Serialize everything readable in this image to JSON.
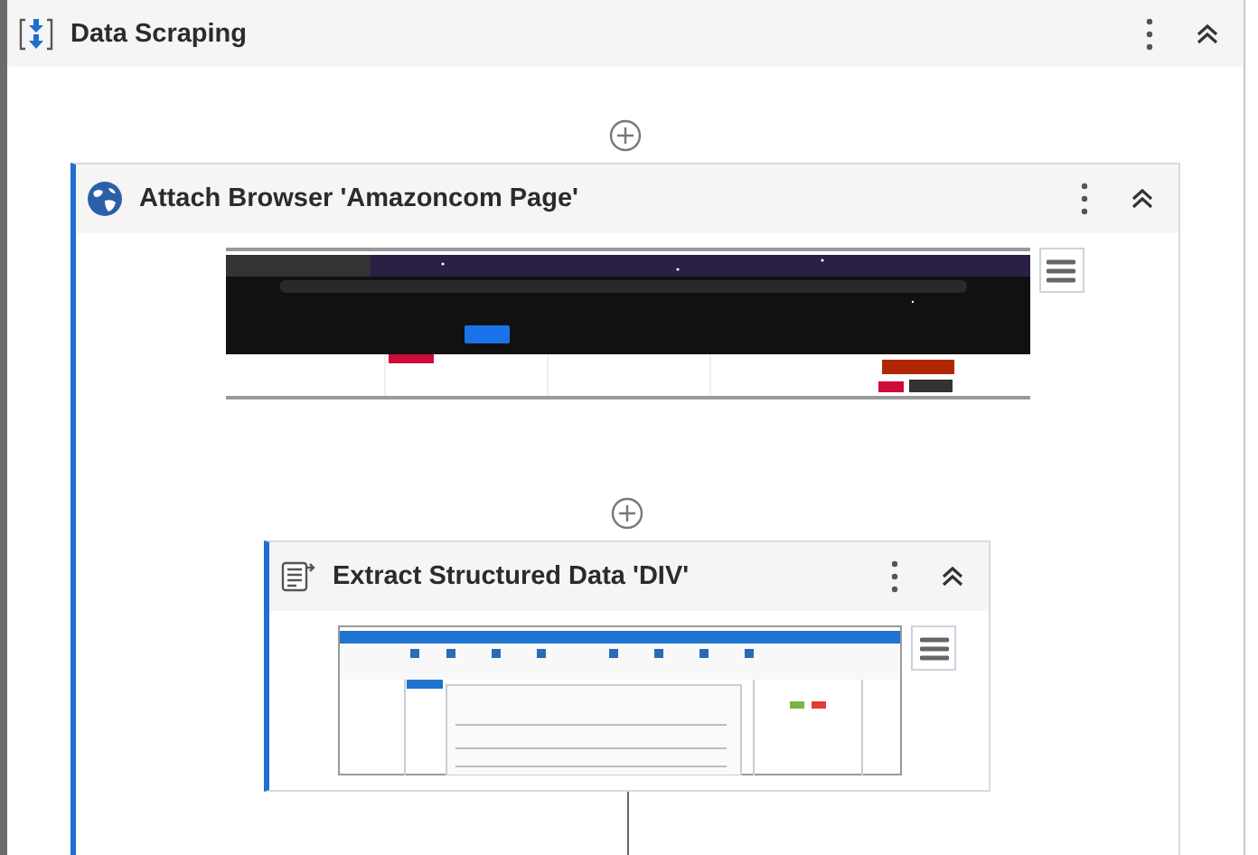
{
  "activities": [
    {
      "title": "Data Scraping",
      "kind": "sequence",
      "expanded": true,
      "children": [
        {
          "title": "Attach Browser 'Amazoncom Page'",
          "kind": "browser",
          "expanded": true,
          "children": [
            {
              "title": "Extract Structured Data 'DIV'",
              "kind": "extract",
              "expanded": true
            }
          ]
        }
      ]
    }
  ]
}
